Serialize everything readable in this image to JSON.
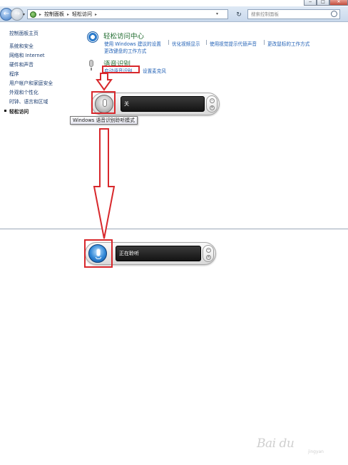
{
  "window": {
    "controls": [
      "−",
      "□",
      "✕"
    ]
  },
  "navigation": {
    "back_icon": "back-arrow-icon",
    "forward_icon": "forward-arrow-icon",
    "dropdown_glyph": "▾",
    "breadcrumbs": [
      "控制面板",
      "轻松访问"
    ],
    "separator": "▸",
    "refresh_glyph": "↻",
    "search_placeholder": "搜索控制面板"
  },
  "sidebar": {
    "items": [
      "控制面板主页",
      "系统和安全",
      "网络和 Internet",
      "硬件和声音",
      "程序",
      "用户帐户和家庭安全",
      "外观和个性化",
      "时钟、语言和区域",
      "轻松访问"
    ],
    "current": "轻松访问"
  },
  "ease_center": {
    "title": "轻松访问中心",
    "links": [
      "使用 Windows 建议的设置",
      "优化视频显示",
      "使用视觉提示代替声音",
      "更改鼠标的工作方式",
      "更改键盘的工作方式"
    ]
  },
  "speech": {
    "title": "语音识别",
    "links": [
      "启动语音识别",
      "设置麦克风"
    ]
  },
  "speech_bar_off": {
    "status": "关",
    "tooltip": "Windows 语音识别聆听模式"
  },
  "speech_bar_on": {
    "status": "正在聆听"
  },
  "colors": {
    "highlight": "#d8282c",
    "link": "#1f5fb5",
    "heading": "#1f6b2e"
  },
  "watermark": {
    "brand": "Bai du",
    "sub": "jingyan"
  }
}
